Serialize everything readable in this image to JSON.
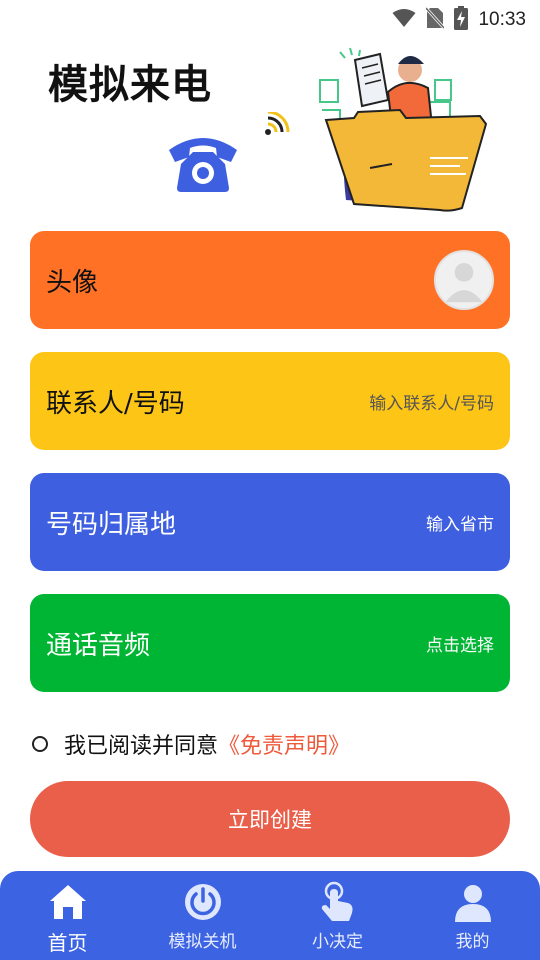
{
  "status_bar": {
    "time": "10:33",
    "icons": [
      "wifi-icon",
      "no-sim-icon",
      "battery-icon"
    ]
  },
  "header": {
    "title": "模拟来电",
    "icons": [
      "telephone-icon",
      "signal-icon",
      "illustration"
    ]
  },
  "form": {
    "avatar": {
      "label": "头像"
    },
    "contact": {
      "label": "联系人/号码",
      "placeholder": "输入联系人/号码"
    },
    "region": {
      "label": "号码归属地",
      "placeholder": "输入省市"
    },
    "audio": {
      "label": "通话音频",
      "placeholder": "点击选择"
    }
  },
  "agreement": {
    "text": "我已阅读并同意",
    "link": "《免责声明》"
  },
  "create_button": "立即创建",
  "colors": {
    "orange": "#ff7226",
    "yellow": "#fdc516",
    "blue": "#3d5fe0",
    "green": "#00b533",
    "red": "#ea5f49",
    "tabbar": "#3c63e1"
  },
  "tabs": [
    {
      "label": "首页",
      "icon": "home-icon",
      "active": true
    },
    {
      "label": "模拟关机",
      "icon": "power-icon",
      "active": false
    },
    {
      "label": "小决定",
      "icon": "tap-hand-icon",
      "active": false
    },
    {
      "label": "我的",
      "icon": "user-icon",
      "active": false
    }
  ]
}
